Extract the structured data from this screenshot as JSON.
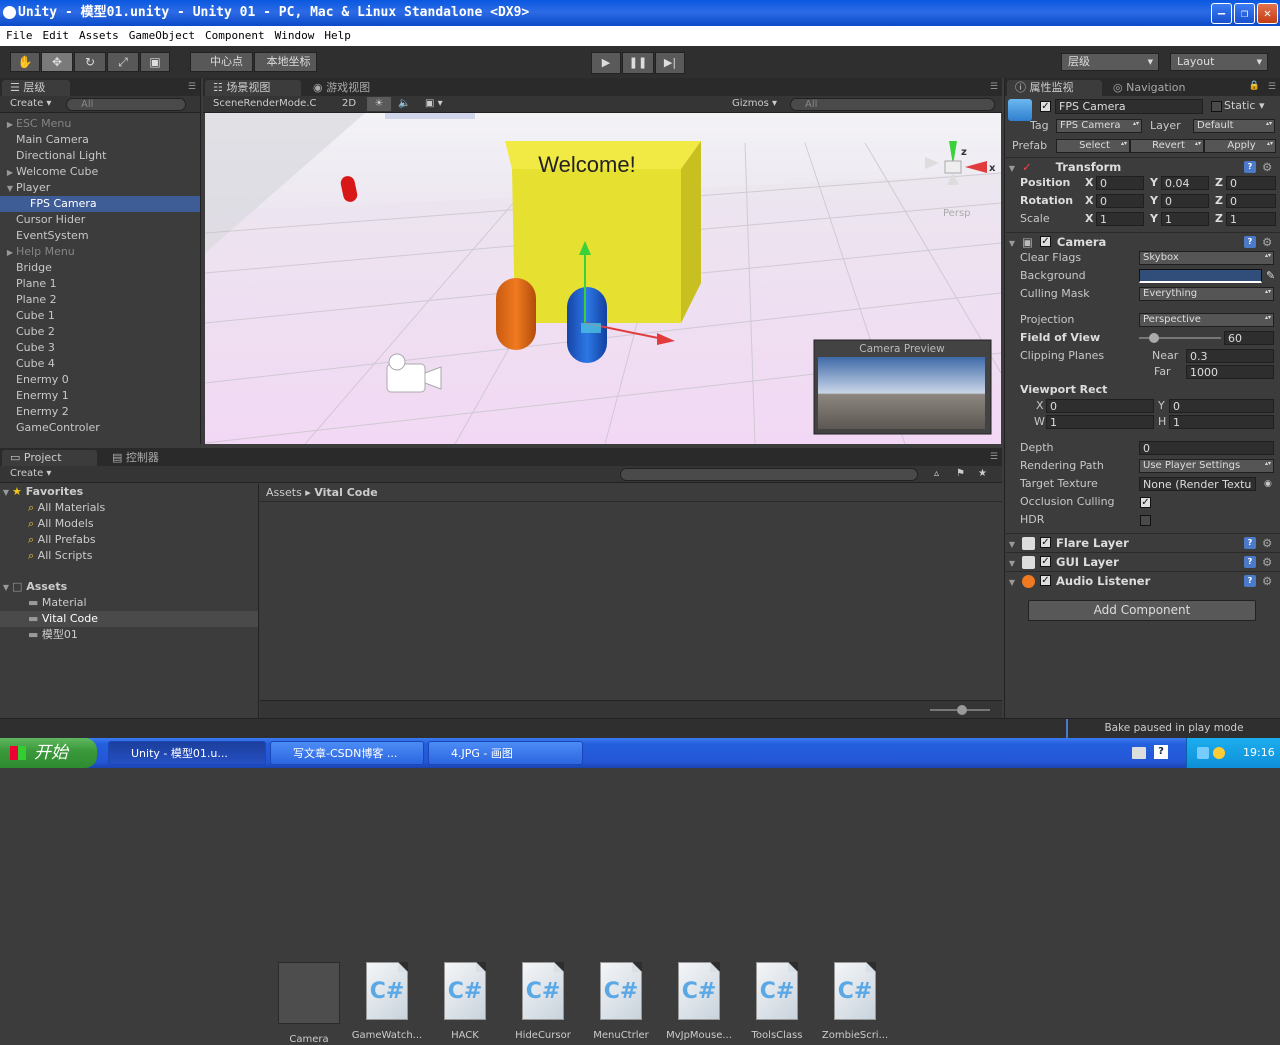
{
  "window": {
    "title": "Unity - 模型01.unity - Unity 01 - PC, Mac & Linux Standalone <DX9>"
  },
  "menu": [
    "File",
    "Edit",
    "Assets",
    "GameObject",
    "Component",
    "Window",
    "Help"
  ],
  "toolbar": {
    "pivot": "中心点",
    "local": "本地坐标",
    "layers": "层级",
    "layout": "Layout"
  },
  "hierarchy": {
    "tab": "层级",
    "create": "Create",
    "search_placeholder": "All",
    "items": [
      {
        "label": "ESC Menu",
        "grey": true,
        "arrow": "right",
        "indent": 0
      },
      {
        "label": "Main Camera",
        "indent": 0
      },
      {
        "label": "Directional Light",
        "indent": 0
      },
      {
        "label": "Welcome Cube",
        "arrow": "right",
        "indent": 0
      },
      {
        "label": "Player",
        "arrow": "down",
        "indent": 0
      },
      {
        "label": "FPS Camera",
        "indent": 1,
        "selected": true
      },
      {
        "label": "Cursor Hider",
        "indent": 0
      },
      {
        "label": "EventSystem",
        "indent": 0
      },
      {
        "label": "Help Menu",
        "grey": true,
        "arrow": "right",
        "indent": 0
      },
      {
        "label": "Bridge",
        "indent": 0
      },
      {
        "label": "Plane 1",
        "indent": 0
      },
      {
        "label": "Plane 2",
        "indent": 0
      },
      {
        "label": "Cube 1",
        "indent": 0
      },
      {
        "label": "Cube 2",
        "indent": 0
      },
      {
        "label": "Cube 3",
        "indent": 0
      },
      {
        "label": "Cube 4",
        "indent": 0
      },
      {
        "label": "Enermy 0",
        "indent": 0
      },
      {
        "label": "Enermy 1",
        "indent": 0
      },
      {
        "label": "Enermy 2",
        "indent": 0
      },
      {
        "label": "GameControler",
        "indent": 0
      }
    ]
  },
  "scene": {
    "tab_scene": "场景视图",
    "tab_game": "游戏视图",
    "render_mode": "SceneRenderMode.C",
    "btn_2d": "2D",
    "gizmos": "Gizmos",
    "search_placeholder": "All",
    "cube_text": "Welcome!",
    "persp": "Persp",
    "gizmo_x": "x",
    "gizmo_z": "z",
    "preview_title": "Camera Preview"
  },
  "project": {
    "tab_project": "Project",
    "tab_console": "控制器",
    "create": "Create",
    "favorites_label": "Favorites",
    "favorites": [
      "All Materials",
      "All Models",
      "All Prefabs",
      "All Scripts"
    ],
    "assets_label": "Assets",
    "folders": [
      {
        "label": "Material"
      },
      {
        "label": "Vital Code",
        "selected": true
      },
      {
        "label": "模型01"
      }
    ],
    "breadcrumb": [
      "Assets",
      "Vital Code"
    ],
    "files": [
      {
        "label": "Camera",
        "kind": "prefab"
      },
      {
        "label": "GameWatch...",
        "kind": "cs"
      },
      {
        "label": "HACK",
        "kind": "cs"
      },
      {
        "label": "HideCursor",
        "kind": "cs"
      },
      {
        "label": "MenuCtrler",
        "kind": "cs"
      },
      {
        "label": "MvJpMouse...",
        "kind": "cs"
      },
      {
        "label": "ToolsClass",
        "kind": "cs"
      },
      {
        "label": "ZombieScri...",
        "kind": "cs"
      }
    ],
    "cs_glyph": "C#"
  },
  "inspector": {
    "tab": "属性监视",
    "tab_nav": "Navigation",
    "object_name": "FPS Camera",
    "static_label": "Static",
    "tag_label": "Tag",
    "tag_value": "FPS Camera",
    "layer_label": "Layer",
    "layer_value": "Default",
    "prefab_label": "Prefab",
    "prefab_select": "Select",
    "prefab_revert": "Revert",
    "prefab_apply": "Apply",
    "transform": {
      "title": "Transform",
      "position": {
        "label": "Position",
        "x": "0",
        "y": "0.04",
        "z": "0"
      },
      "rotation": {
        "label": "Rotation",
        "x": "0",
        "y": "0",
        "z": "0"
      },
      "scale": {
        "label": "Scale",
        "x": "1",
        "y": "1",
        "z": "1"
      }
    },
    "axis": {
      "x": "X",
      "y": "Y",
      "z": "Z",
      "w": "W",
      "h": "H"
    },
    "camera": {
      "title": "Camera",
      "clear_flags_label": "Clear Flags",
      "clear_flags": "Skybox",
      "background_label": "Background",
      "background_color": "#314d79",
      "culling_mask_label": "Culling Mask",
      "culling_mask": "Everything",
      "projection_label": "Projection",
      "projection": "Perspective",
      "fov_label": "Field of View",
      "fov": "60",
      "fov_fraction": 0.18,
      "clipping_label": "Clipping Planes",
      "near_label": "Near",
      "near": "0.3",
      "far_label": "Far",
      "far": "1000",
      "viewport_label": "Viewport Rect",
      "vx": "0",
      "vy": "0",
      "vw": "1",
      "vh": "1",
      "depth_label": "Depth",
      "depth": "0",
      "rendering_path_label": "Rendering Path",
      "rendering_path": "Use Player Settings",
      "target_texture_label": "Target Texture",
      "target_texture": "None (Render Textu",
      "occlusion_label": "Occlusion Culling",
      "hdr_label": "HDR"
    },
    "components": [
      "Flare Layer",
      "GUI Layer",
      "Audio Listener"
    ],
    "add_component": "Add Component"
  },
  "status": {
    "message": "Bake paused in play mode"
  },
  "taskbar": {
    "start": "开始",
    "tasks": [
      "Unity - 模型01.u...",
      "写文章-CSDN博客 ...",
      "4.JPG - 画图"
    ],
    "time": "19:16"
  }
}
